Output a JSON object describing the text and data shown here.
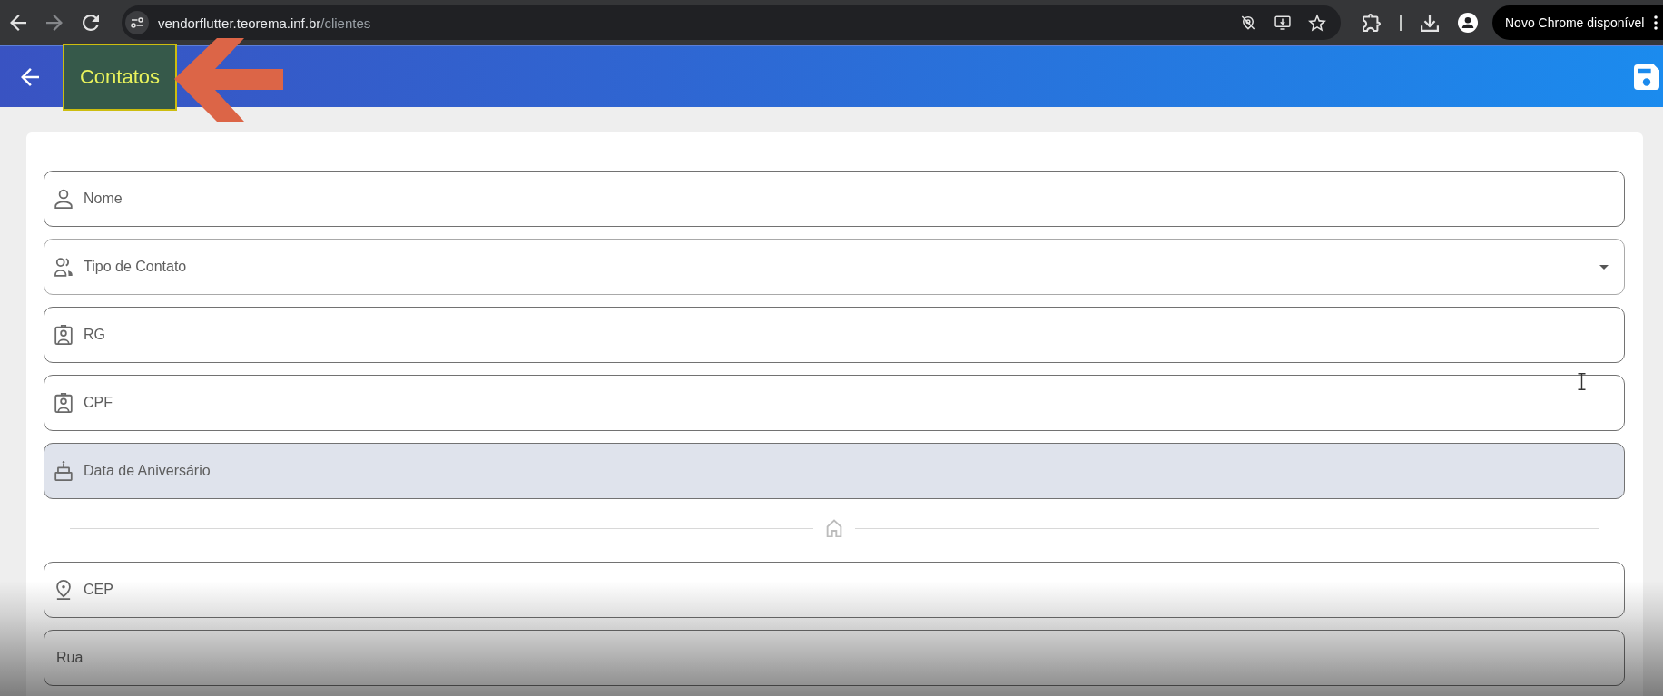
{
  "browser": {
    "nav_buttons": [
      {
        "disabled": false
      },
      {
        "disabled": true
      },
      {
        "disabled": false
      }
    ],
    "url": {
      "host": "vendorflutter.teorema.inf.br",
      "path": "/clientes"
    },
    "update_button": "Novo Chrome disponível"
  },
  "app_bar": {
    "title": "Contatos"
  },
  "form": {
    "personal_fields": [
      {
        "kind": "text",
        "label": "Nome"
      },
      {
        "kind": "select",
        "label": "Tipo de Contato"
      },
      {
        "kind": "text",
        "label": "RG"
      },
      {
        "kind": "text",
        "label": "CPF"
      },
      {
        "kind": "date",
        "label": "Data de Aniversário"
      }
    ],
    "address_fields": [
      {
        "kind": "text",
        "label": "CEP"
      },
      {
        "kind": "text",
        "label": "Rua"
      }
    ]
  }
}
